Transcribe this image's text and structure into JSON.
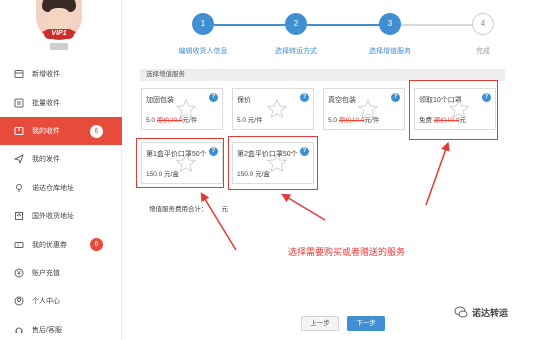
{
  "profile": {
    "vip_label": "VIP1"
  },
  "sidebar": {
    "items": [
      {
        "label": "新增收件",
        "icon": "inbox-icon"
      },
      {
        "label": "批量收件",
        "icon": "batch-icon"
      },
      {
        "label": "我的收件",
        "icon": "package-icon",
        "count": "6",
        "active": true
      },
      {
        "label": "我的发件",
        "icon": "send-icon"
      },
      {
        "label": "诺达仓库地址",
        "icon": "location-icon"
      },
      {
        "label": "国外收货地址",
        "icon": "globe-icon"
      },
      {
        "label": "我的优惠券",
        "icon": "coupon-icon",
        "count": "6"
      },
      {
        "label": "账户充值",
        "icon": "yen-icon"
      },
      {
        "label": "个人中心",
        "icon": "user-icon"
      },
      {
        "label": "售后/客服",
        "icon": "service-icon"
      }
    ]
  },
  "stepper": {
    "steps": [
      {
        "num": "1",
        "label": "编辑收货人信息"
      },
      {
        "num": "2",
        "label": "选择转运方式"
      },
      {
        "num": "3",
        "label": "选择增值服务"
      },
      {
        "num": "4",
        "label": "完成"
      }
    ],
    "current": 3
  },
  "services": {
    "title": "选择增值服务",
    "cards": [
      {
        "name": "加固包装",
        "price": "5.0",
        "orig": "原价20.0",
        "unit": "元/件"
      },
      {
        "name": "保价",
        "price": "5.0 元/件",
        "orig": "",
        "unit": ""
      },
      {
        "name": "真空包装",
        "price": "5.0",
        "orig": "原价10.0",
        "unit": "元/件"
      },
      {
        "name": "领取10个口罩",
        "price": "免费",
        "orig": "原价10.0",
        "unit": "元"
      },
      {
        "name": "第1盒平价口罩50个",
        "price": "150.0 元/盒",
        "orig": "",
        "unit": ""
      },
      {
        "name": "第2盒平价口罩50个",
        "price": "150.0 元/盒",
        "orig": "",
        "unit": ""
      }
    ],
    "help_mark": "?",
    "total_label": "增值服务费用合计：",
    "total_unit": "元"
  },
  "annotation": {
    "text": "选择需要购买或者赠送的服务",
    "color": "#e53935"
  },
  "buttons": {
    "prev": "上一步",
    "next": "下一步"
  },
  "watermark": {
    "text": "诺达转运"
  },
  "colors": {
    "accent": "#e74b3c",
    "primary": "#3f8fd2"
  }
}
